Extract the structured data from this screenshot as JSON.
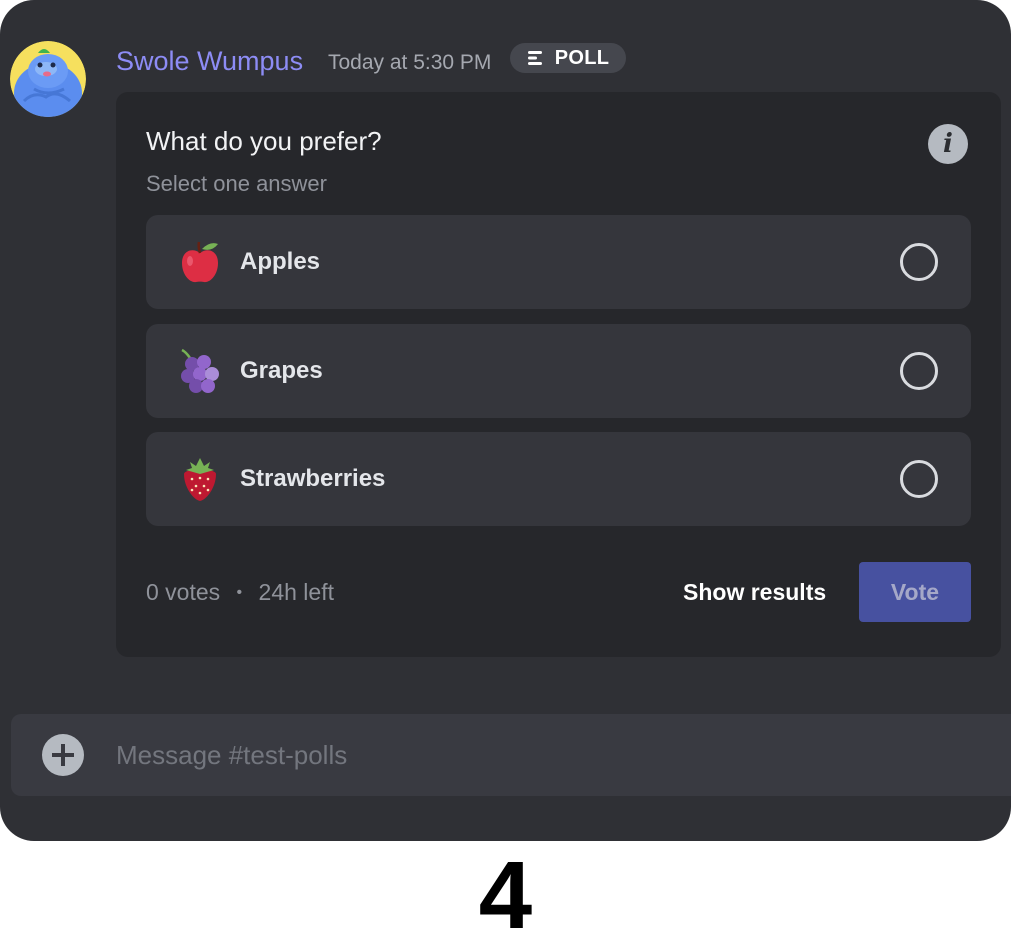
{
  "message": {
    "username": "Swole Wumpus",
    "timestamp": "Today at 5:30 PM",
    "badge": {
      "icon": "poll-icon",
      "label": "POLL"
    },
    "avatar": {
      "icon": "wumpus-avatar-icon"
    }
  },
  "poll": {
    "question": "What do you prefer?",
    "subtitle": "Select one answer",
    "info_icon": "info-icon",
    "answers": [
      {
        "label": "Apples",
        "icon": "apple-emoji-icon",
        "selected": false
      },
      {
        "label": "Grapes",
        "icon": "grapes-emoji-icon",
        "selected": false
      },
      {
        "label": "Strawberries",
        "icon": "strawberry-emoji-icon",
        "selected": false
      }
    ],
    "votes": "0 votes",
    "separator": "•",
    "time_left": "24h left",
    "show_results_label": "Show results",
    "vote_label": "Vote"
  },
  "composer": {
    "placeholder": "Message #test-polls",
    "add_icon": "plus-circle-icon"
  },
  "page_number": "4",
  "colors": {
    "background": "#2f3035",
    "card": "#26272b",
    "answer": "#35363c",
    "username": "#8d8cf5",
    "vote_button": "#4751a0"
  }
}
